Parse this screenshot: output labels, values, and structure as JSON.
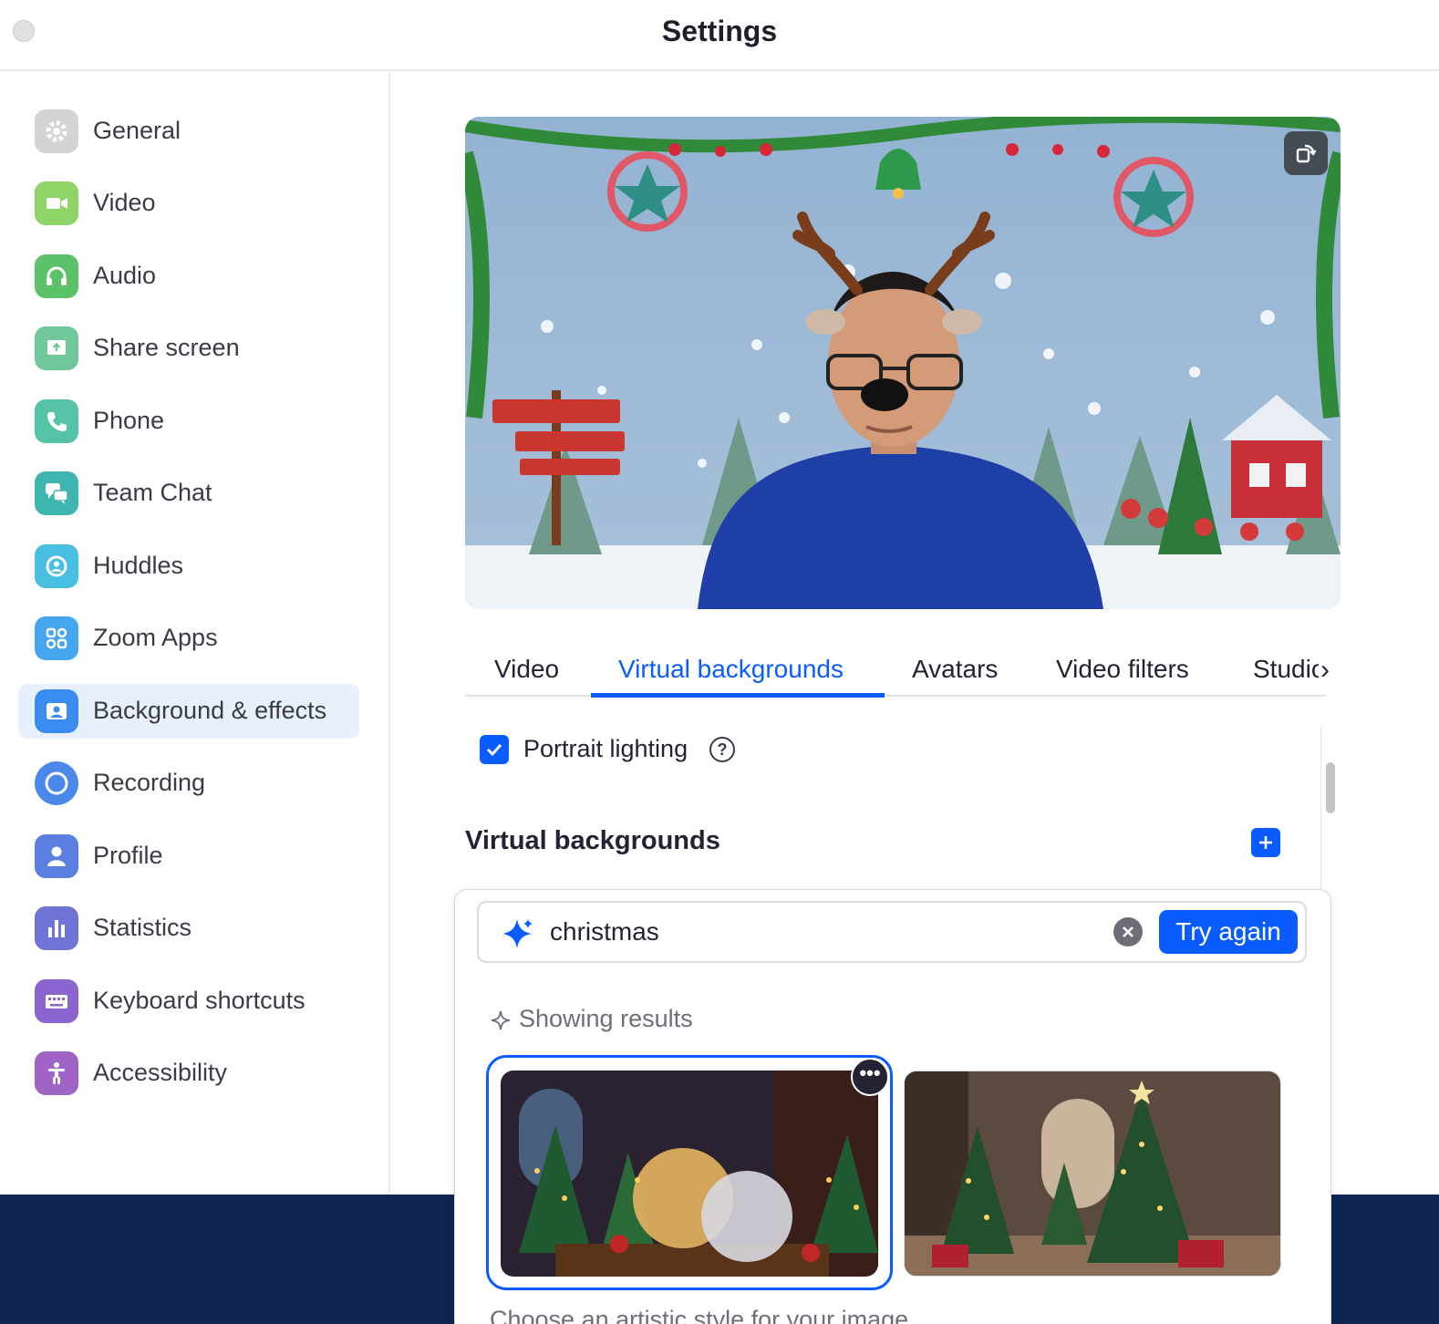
{
  "window": {
    "title": "Settings"
  },
  "sidebar": {
    "items": [
      {
        "label": "General",
        "icon": "gear-icon",
        "color": "#c9c9cc"
      },
      {
        "label": "Video",
        "icon": "video-camera-icon",
        "color": "#8fd468"
      },
      {
        "label": "Audio",
        "icon": "headphones-icon",
        "color": "#5cc26a"
      },
      {
        "label": "Share screen",
        "icon": "share-screen-icon",
        "color": "#6fc79a"
      },
      {
        "label": "Phone",
        "icon": "phone-icon",
        "color": "#56c3a6"
      },
      {
        "label": "Team Chat",
        "icon": "chat-bubbles-icon",
        "color": "#3fb5b0"
      },
      {
        "label": "Huddles",
        "icon": "huddles-icon",
        "color": "#48bfe0"
      },
      {
        "label": "Zoom Apps",
        "icon": "apps-icon",
        "color": "#45a6ef"
      },
      {
        "label": "Background & effects",
        "icon": "background-portrait-icon",
        "color": "#3a8cf0"
      },
      {
        "label": "Recording",
        "icon": "record-icon",
        "color": "#4a88ea"
      },
      {
        "label": "Profile",
        "icon": "person-icon",
        "color": "#5b7fe0"
      },
      {
        "label": "Statistics",
        "icon": "bar-chart-icon",
        "color": "#6f74d6"
      },
      {
        "label": "Keyboard shortcuts",
        "icon": "keyboard-icon",
        "color": "#8a64cf"
      },
      {
        "label": "Accessibility",
        "icon": "accessibility-icon",
        "color": "#a064c6"
      }
    ],
    "active": "Background & effects"
  },
  "tabs": {
    "items": [
      "Video",
      "Virtual backgrounds",
      "Avatars",
      "Video filters",
      "Studio"
    ],
    "active": "Virtual backgrounds",
    "overflow_arrow": "›"
  },
  "portrait_lighting": {
    "label": "Portrait lighting",
    "checked": true,
    "help": "?"
  },
  "virtual_backgrounds": {
    "heading": "Virtual backgrounds",
    "add_label": "+"
  },
  "generator": {
    "prompt": "christmas",
    "try_again": "Try again",
    "showing": "Showing results",
    "more": "•••",
    "artistic_hint": "Choose an artistic style for your image"
  },
  "colors": {
    "accent": "#0b5cff",
    "bottom_bar": "#0e2452"
  }
}
